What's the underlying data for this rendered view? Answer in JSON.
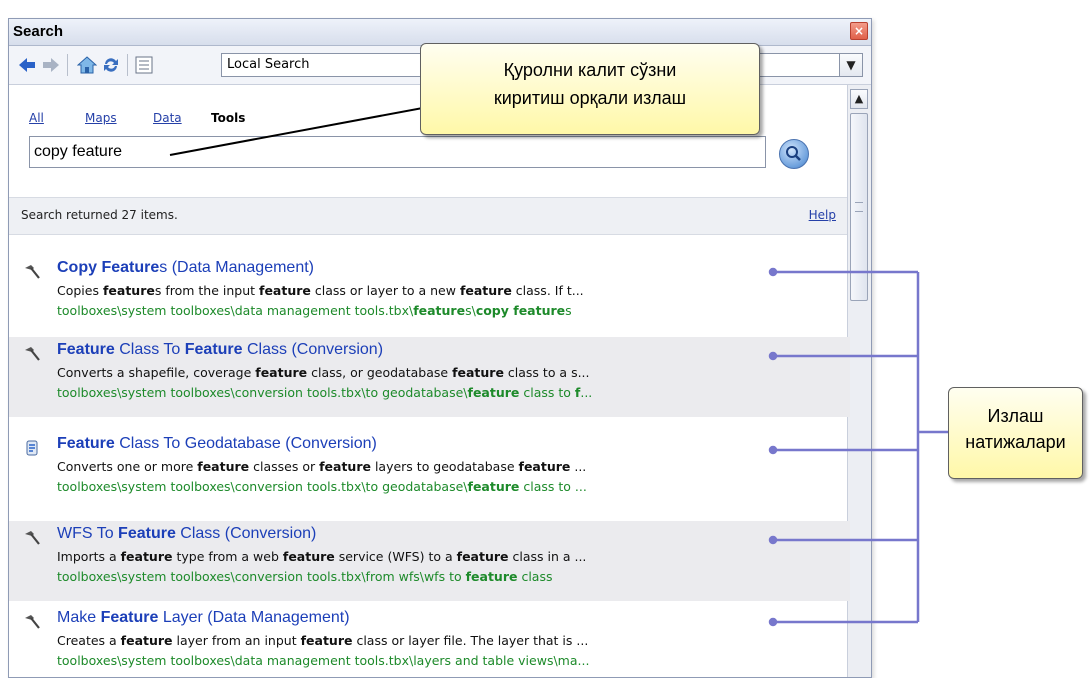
{
  "window": {
    "title": "Search",
    "close": "×"
  },
  "toolbar": {
    "location_value": "Local Search",
    "icons": [
      "back-arrow-icon",
      "forward-arrow-icon",
      "home-icon",
      "refresh-icon",
      "options-icon"
    ]
  },
  "tabs": [
    {
      "label": "All"
    },
    {
      "label": "Maps"
    },
    {
      "label": "Data"
    },
    {
      "label": "Tools"
    }
  ],
  "search": {
    "value": "copy feature"
  },
  "status": {
    "text": "Search returned 27 items.",
    "help": "Help"
  },
  "results": [
    {
      "title": [
        {
          "t": "Copy Feature",
          "b": true
        },
        {
          "t": "s (Data Management)",
          "b": false
        }
      ],
      "desc": [
        {
          "t": "Copies ",
          "b": false
        },
        {
          "t": "feature",
          "b": true
        },
        {
          "t": "s from the input ",
          "b": false
        },
        {
          "t": "feature",
          "b": true
        },
        {
          "t": " class or layer to a new ",
          "b": false
        },
        {
          "t": "feature",
          "b": true
        },
        {
          "t": " class. If t...",
          "b": false
        }
      ],
      "path": [
        {
          "t": "toolboxes\\system toolboxes\\data management tools.tbx\\",
          "b": false
        },
        {
          "t": "feature",
          "b": true
        },
        {
          "t": "s\\",
          "b": false
        },
        {
          "t": "copy feature",
          "b": true
        },
        {
          "t": "s",
          "b": false
        }
      ],
      "icon": "hammer-icon"
    },
    {
      "title": [
        {
          "t": "Feature",
          "b": true
        },
        {
          "t": " Class To ",
          "b": false
        },
        {
          "t": "Feature",
          "b": true
        },
        {
          "t": " Class (Conversion)",
          "b": false
        }
      ],
      "desc": [
        {
          "t": "Converts a shapefile, coverage ",
          "b": false
        },
        {
          "t": "feature",
          "b": true
        },
        {
          "t": " class, or geodatabase ",
          "b": false
        },
        {
          "t": "feature",
          "b": true
        },
        {
          "t": " class to a s...",
          "b": false
        }
      ],
      "path": [
        {
          "t": "toolboxes\\system toolboxes\\conversion tools.tbx\\to geodatabase\\",
          "b": false
        },
        {
          "t": "feature",
          "b": true
        },
        {
          "t": " class to ",
          "b": false
        },
        {
          "t": "f",
          "b": true
        },
        {
          "t": "...",
          "b": false
        }
      ],
      "icon": "hammer-icon"
    },
    {
      "title": [
        {
          "t": "Feature",
          "b": true
        },
        {
          "t": " Class To Geodatabase (Conversion)",
          "b": false
        }
      ],
      "desc": [
        {
          "t": "Converts one or more ",
          "b": false
        },
        {
          "t": "feature",
          "b": true
        },
        {
          "t": " classes or ",
          "b": false
        },
        {
          "t": "feature",
          "b": true
        },
        {
          "t": " layers to geodatabase ",
          "b": false
        },
        {
          "t": "feature",
          "b": true
        },
        {
          "t": " ...",
          "b": false
        }
      ],
      "path": [
        {
          "t": "toolboxes\\system toolboxes\\conversion tools.tbx\\to geodatabase\\",
          "b": false
        },
        {
          "t": "feature",
          "b": true
        },
        {
          "t": " class to ...",
          "b": false
        }
      ],
      "icon": "script-icon"
    },
    {
      "title": [
        {
          "t": "WFS To ",
          "b": false
        },
        {
          "t": "Feature",
          "b": true
        },
        {
          "t": " Class (Conversion)",
          "b": false
        }
      ],
      "desc": [
        {
          "t": "Imports a ",
          "b": false
        },
        {
          "t": "feature",
          "b": true
        },
        {
          "t": " type from a web ",
          "b": false
        },
        {
          "t": "feature",
          "b": true
        },
        {
          "t": " service (WFS) to a ",
          "b": false
        },
        {
          "t": "feature",
          "b": true
        },
        {
          "t": " class in a ...",
          "b": false
        }
      ],
      "path": [
        {
          "t": "toolboxes\\system toolboxes\\conversion tools.tbx\\from wfs\\wfs to ",
          "b": false
        },
        {
          "t": "feature",
          "b": true
        },
        {
          "t": " class",
          "b": false
        }
      ],
      "icon": "hammer-icon"
    },
    {
      "title": [
        {
          "t": "Make ",
          "b": false
        },
        {
          "t": "Feature",
          "b": true
        },
        {
          "t": " Layer (Data Management)",
          "b": false
        }
      ],
      "desc": [
        {
          "t": "Creates a ",
          "b": false
        },
        {
          "t": "feature",
          "b": true
        },
        {
          "t": " layer from an input ",
          "b": false
        },
        {
          "t": "feature",
          "b": true
        },
        {
          "t": " class or layer file. The layer that is ...",
          "b": false
        }
      ],
      "path": [
        {
          "t": "toolboxes\\system toolboxes\\data management tools.tbx\\layers and table views\\ma...",
          "b": false
        }
      ],
      "icon": "hammer-icon"
    }
  ],
  "callouts": {
    "search_note": {
      "line1": "Қуролни калит сўзни",
      "line2": "киритиш орқали излаш"
    },
    "results_note": {
      "line1": "Излаш",
      "line2": "натижалари"
    }
  },
  "colors": {
    "title_link": "#1c3fb8",
    "path_green": "#1d8a2a",
    "callout_bg": "#fff8a8",
    "connector": "#7777cc"
  }
}
